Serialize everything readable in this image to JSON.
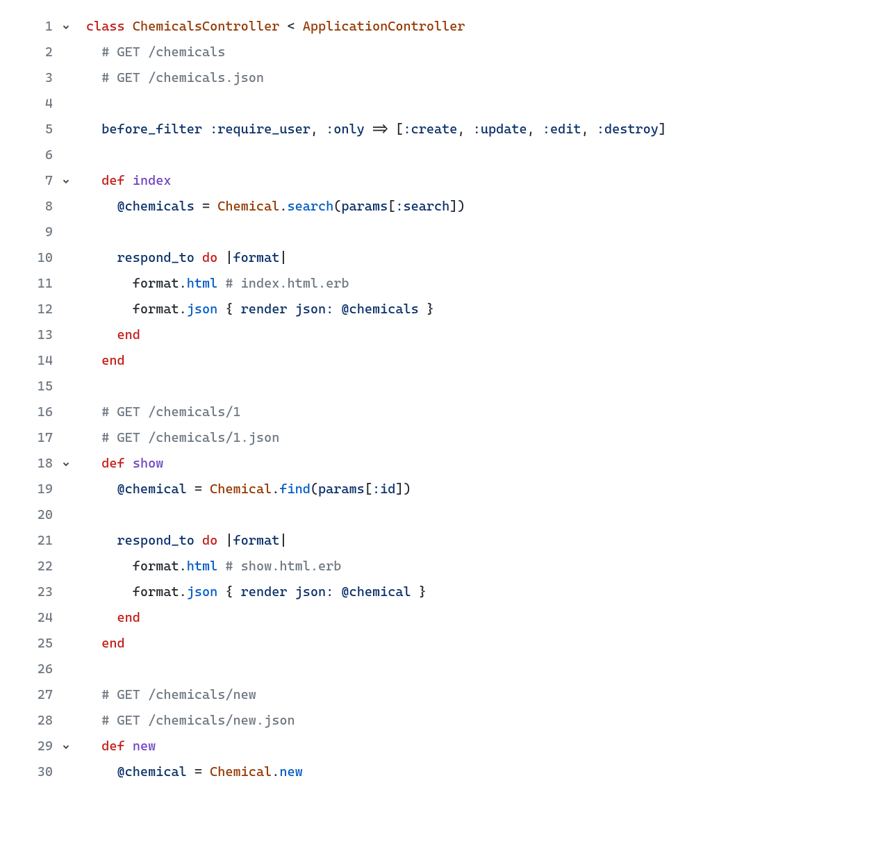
{
  "lines": [
    {
      "num": 1,
      "fold": true
    },
    {
      "num": 2,
      "fold": false
    },
    {
      "num": 3,
      "fold": false
    },
    {
      "num": 4,
      "fold": false
    },
    {
      "num": 5,
      "fold": false
    },
    {
      "num": 6,
      "fold": false
    },
    {
      "num": 7,
      "fold": true
    },
    {
      "num": 8,
      "fold": false
    },
    {
      "num": 9,
      "fold": false
    },
    {
      "num": 10,
      "fold": false
    },
    {
      "num": 11,
      "fold": false
    },
    {
      "num": 12,
      "fold": false
    },
    {
      "num": 13,
      "fold": false
    },
    {
      "num": 14,
      "fold": false
    },
    {
      "num": 15,
      "fold": false
    },
    {
      "num": 16,
      "fold": false
    },
    {
      "num": 17,
      "fold": false
    },
    {
      "num": 18,
      "fold": true
    },
    {
      "num": 19,
      "fold": false
    },
    {
      "num": 20,
      "fold": false
    },
    {
      "num": 21,
      "fold": false
    },
    {
      "num": 22,
      "fold": false
    },
    {
      "num": 23,
      "fold": false
    },
    {
      "num": 24,
      "fold": false
    },
    {
      "num": 25,
      "fold": false
    },
    {
      "num": 26,
      "fold": false
    },
    {
      "num": 27,
      "fold": false
    },
    {
      "num": 28,
      "fold": false
    },
    {
      "num": 29,
      "fold": true
    },
    {
      "num": 30,
      "fold": false
    }
  ],
  "code": {
    "l1": [
      {
        "t": "class",
        "c": "red"
      },
      {
        "t": " ",
        "c": "plain"
      },
      {
        "t": "ChemicalsController",
        "c": "brown"
      },
      {
        "t": " < ",
        "c": "plain"
      },
      {
        "t": "ApplicationController",
        "c": "brown"
      }
    ],
    "l2": [
      {
        "t": "  ",
        "c": "plain"
      },
      {
        "t": "# GET /chemicals",
        "c": "grey"
      }
    ],
    "l3": [
      {
        "t": "  ",
        "c": "plain"
      },
      {
        "t": "# GET /chemicals.json",
        "c": "grey"
      }
    ],
    "l4": [
      {
        "t": "",
        "c": "plain"
      }
    ],
    "l5": [
      {
        "t": "  ",
        "c": "plain"
      },
      {
        "t": "before_filter",
        "c": "navy"
      },
      {
        "t": " ",
        "c": "plain"
      },
      {
        "t": ":require_user",
        "c": "navy"
      },
      {
        "t": ", ",
        "c": "plain"
      },
      {
        "t": ":only",
        "c": "navy"
      },
      {
        "t": " => [",
        "c": "plain"
      },
      {
        "t": ":create",
        "c": "navy"
      },
      {
        "t": ", ",
        "c": "plain"
      },
      {
        "t": ":update",
        "c": "navy"
      },
      {
        "t": ", ",
        "c": "plain"
      },
      {
        "t": ":edit",
        "c": "navy"
      },
      {
        "t": ", ",
        "c": "plain"
      },
      {
        "t": ":destroy",
        "c": "navy"
      },
      {
        "t": "]",
        "c": "plain"
      }
    ],
    "l6": [
      {
        "t": "",
        "c": "plain"
      }
    ],
    "l7": [
      {
        "t": "  ",
        "c": "plain"
      },
      {
        "t": "def",
        "c": "red"
      },
      {
        "t": " ",
        "c": "plain"
      },
      {
        "t": "index",
        "c": "purple"
      }
    ],
    "l8": [
      {
        "t": "    ",
        "c": "plain"
      },
      {
        "t": "@chemicals",
        "c": "navy"
      },
      {
        "t": " = ",
        "c": "plain"
      },
      {
        "t": "Chemical",
        "c": "brown"
      },
      {
        "t": ".",
        "c": "plain"
      },
      {
        "t": "search",
        "c": "teal"
      },
      {
        "t": "(",
        "c": "plain"
      },
      {
        "t": "params",
        "c": "navy"
      },
      {
        "t": "[",
        "c": "plain"
      },
      {
        "t": ":search",
        "c": "navy"
      },
      {
        "t": "])",
        "c": "plain"
      }
    ],
    "l9": [
      {
        "t": "",
        "c": "plain"
      }
    ],
    "l10": [
      {
        "t": "    ",
        "c": "plain"
      },
      {
        "t": "respond_to",
        "c": "navy"
      },
      {
        "t": " ",
        "c": "plain"
      },
      {
        "t": "do",
        "c": "red"
      },
      {
        "t": " |",
        "c": "plain"
      },
      {
        "t": "format",
        "c": "navy"
      },
      {
        "t": "|",
        "c": "plain"
      }
    ],
    "l11": [
      {
        "t": "      ",
        "c": "plain"
      },
      {
        "t": "format.",
        "c": "plain"
      },
      {
        "t": "html",
        "c": "teal"
      },
      {
        "t": " ",
        "c": "plain"
      },
      {
        "t": "# index.html.erb",
        "c": "grey"
      }
    ],
    "l12": [
      {
        "t": "      ",
        "c": "plain"
      },
      {
        "t": "format.",
        "c": "plain"
      },
      {
        "t": "json",
        "c": "teal"
      },
      {
        "t": " { ",
        "c": "plain"
      },
      {
        "t": "render",
        "c": "navy"
      },
      {
        "t": " ",
        "c": "plain"
      },
      {
        "t": "json:",
        "c": "navy"
      },
      {
        "t": " ",
        "c": "plain"
      },
      {
        "t": "@chemicals",
        "c": "navy"
      },
      {
        "t": " }",
        "c": "plain"
      }
    ],
    "l13": [
      {
        "t": "    ",
        "c": "plain"
      },
      {
        "t": "end",
        "c": "red"
      }
    ],
    "l14": [
      {
        "t": "  ",
        "c": "plain"
      },
      {
        "t": "end",
        "c": "red"
      }
    ],
    "l15": [
      {
        "t": "",
        "c": "plain"
      }
    ],
    "l16": [
      {
        "t": "  ",
        "c": "plain"
      },
      {
        "t": "# GET /chemicals/1",
        "c": "grey"
      }
    ],
    "l17": [
      {
        "t": "  ",
        "c": "plain"
      },
      {
        "t": "# GET /chemicals/1.json",
        "c": "grey"
      }
    ],
    "l18": [
      {
        "t": "  ",
        "c": "plain"
      },
      {
        "t": "def",
        "c": "red"
      },
      {
        "t": " ",
        "c": "plain"
      },
      {
        "t": "show",
        "c": "purple"
      }
    ],
    "l19": [
      {
        "t": "    ",
        "c": "plain"
      },
      {
        "t": "@chemical",
        "c": "navy"
      },
      {
        "t": " = ",
        "c": "plain"
      },
      {
        "t": "Chemical",
        "c": "brown"
      },
      {
        "t": ".",
        "c": "plain"
      },
      {
        "t": "find",
        "c": "teal"
      },
      {
        "t": "(",
        "c": "plain"
      },
      {
        "t": "params",
        "c": "navy"
      },
      {
        "t": "[",
        "c": "plain"
      },
      {
        "t": ":id",
        "c": "navy"
      },
      {
        "t": "])",
        "c": "plain"
      }
    ],
    "l20": [
      {
        "t": "",
        "c": "plain"
      }
    ],
    "l21": [
      {
        "t": "    ",
        "c": "plain"
      },
      {
        "t": "respond_to",
        "c": "navy"
      },
      {
        "t": " ",
        "c": "plain"
      },
      {
        "t": "do",
        "c": "red"
      },
      {
        "t": " |",
        "c": "plain"
      },
      {
        "t": "format",
        "c": "navy"
      },
      {
        "t": "|",
        "c": "plain"
      }
    ],
    "l22": [
      {
        "t": "      ",
        "c": "plain"
      },
      {
        "t": "format.",
        "c": "plain"
      },
      {
        "t": "html",
        "c": "teal"
      },
      {
        "t": " ",
        "c": "plain"
      },
      {
        "t": "# show.html.erb",
        "c": "grey"
      }
    ],
    "l23": [
      {
        "t": "      ",
        "c": "plain"
      },
      {
        "t": "format.",
        "c": "plain"
      },
      {
        "t": "json",
        "c": "teal"
      },
      {
        "t": " { ",
        "c": "plain"
      },
      {
        "t": "render",
        "c": "navy"
      },
      {
        "t": " ",
        "c": "plain"
      },
      {
        "t": "json:",
        "c": "navy"
      },
      {
        "t": " ",
        "c": "plain"
      },
      {
        "t": "@chemical",
        "c": "navy"
      },
      {
        "t": " }",
        "c": "plain"
      }
    ],
    "l24": [
      {
        "t": "    ",
        "c": "plain"
      },
      {
        "t": "end",
        "c": "red"
      }
    ],
    "l25": [
      {
        "t": "  ",
        "c": "plain"
      },
      {
        "t": "end",
        "c": "red"
      }
    ],
    "l26": [
      {
        "t": "",
        "c": "plain"
      }
    ],
    "l27": [
      {
        "t": "  ",
        "c": "plain"
      },
      {
        "t": "# GET /chemicals/new",
        "c": "grey"
      }
    ],
    "l28": [
      {
        "t": "  ",
        "c": "plain"
      },
      {
        "t": "# GET /chemicals/new.json",
        "c": "grey"
      }
    ],
    "l29": [
      {
        "t": "  ",
        "c": "plain"
      },
      {
        "t": "def",
        "c": "red"
      },
      {
        "t": " ",
        "c": "plain"
      },
      {
        "t": "new",
        "c": "purple"
      }
    ],
    "l30": [
      {
        "t": "    ",
        "c": "plain"
      },
      {
        "t": "@chemical",
        "c": "navy"
      },
      {
        "t": " = ",
        "c": "plain"
      },
      {
        "t": "Chemical",
        "c": "brown"
      },
      {
        "t": ".",
        "c": "plain"
      },
      {
        "t": "new",
        "c": "teal"
      }
    ]
  }
}
